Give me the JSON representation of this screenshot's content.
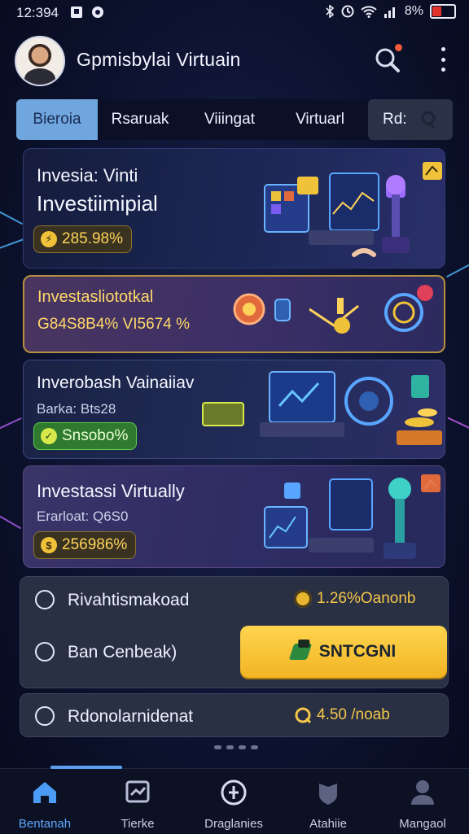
{
  "status_bar": {
    "time": "12:394",
    "battery": "8%",
    "battery_level": 0.38
  },
  "header": {
    "title": "Gpmisbylai Virtuain"
  },
  "tabs": [
    {
      "label": "Bieroia",
      "active": true
    },
    {
      "label": "Rsaruak",
      "active": false
    },
    {
      "label": "Viiingat",
      "active": false
    },
    {
      "label": "Virtuarl",
      "active": false
    },
    {
      "label": "Rd:",
      "active": false
    }
  ],
  "cards": [
    {
      "title": "Invesia: Vinti",
      "title2": "Investiimipial",
      "badge": "285.98%"
    },
    {
      "title": "Investasliototkal",
      "sub": "G84S8B4% VI5674 %"
    },
    {
      "title": "Inverobash Vainaiiav",
      "sub": "Barka: Bts28",
      "badge": "Snsobo%"
    },
    {
      "title": "Investassi Virtually",
      "sub": "Erarloat: Q6S0",
      "badge": "256986%"
    }
  ],
  "info_rows": [
    {
      "label": "Rivahtismakoad",
      "value": "1.26%Oanonb"
    },
    {
      "label": "Ban Cenbeak)",
      "button": "SNTCGNI"
    },
    {
      "label": "Rdonolarnidenat",
      "value": "4.50 /noab"
    }
  ],
  "bottom_nav": [
    {
      "label": "Bentanah",
      "icon": "home-icon",
      "active": true
    },
    {
      "label": "Tierke",
      "icon": "chart-icon",
      "active": false
    },
    {
      "label": "Draglanies",
      "icon": "compass-icon",
      "active": false
    },
    {
      "label": "Atahiie",
      "icon": "shield-icon",
      "active": false
    },
    {
      "label": "Mangaol",
      "icon": "profile-icon",
      "active": false
    }
  ],
  "colors": {
    "accent": "#5fa8ff",
    "gold": "#f4c64a",
    "cta": "#ffd54f",
    "tab_active": "#6fa6dd"
  }
}
